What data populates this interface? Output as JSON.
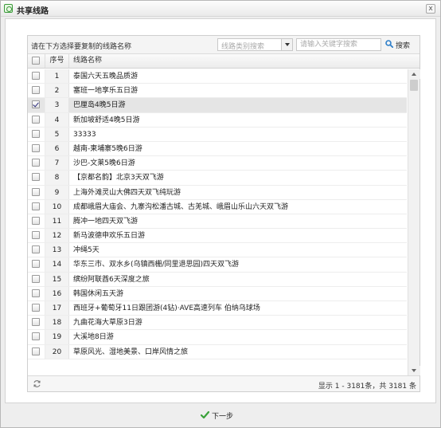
{
  "window": {
    "title": "共享线路",
    "close_label": "x"
  },
  "toolbar": {
    "instruction": "请在下方选择要复制的线路名称",
    "category_placeholder": "线路类别搜索",
    "keyword_placeholder": "请输入关键字搜索",
    "search_label": "搜索"
  },
  "grid": {
    "columns": {
      "seq": "序号",
      "name": "线路名称"
    },
    "rows": [
      {
        "seq": "1",
        "name": "泰国六天五晚品质游",
        "checked": false
      },
      {
        "seq": "2",
        "name": "塞班一地享乐五日游",
        "checked": false
      },
      {
        "seq": "3",
        "name": "巴厘岛4晚5日游",
        "checked": true
      },
      {
        "seq": "4",
        "name": "新加坡舒适4晚5日游",
        "checked": false
      },
      {
        "seq": "5",
        "name": "33333",
        "checked": false
      },
      {
        "seq": "6",
        "name": "越南-柬埔寨5晚6日游",
        "checked": false
      },
      {
        "seq": "7",
        "name": "沙巴-文莱5晚6日游",
        "checked": false
      },
      {
        "seq": "8",
        "name": "【京都名韵】北京3天双飞游",
        "checked": false
      },
      {
        "seq": "9",
        "name": "上海外滩灵山大佛四天双飞纯玩游",
        "checked": false
      },
      {
        "seq": "10",
        "name": "成都峨眉大庙会、九寨沟松潘古城、古羌城、峨眉山乐山六天双飞游",
        "checked": false
      },
      {
        "seq": "11",
        "name": "腾冲一地四天双飞游",
        "checked": false
      },
      {
        "seq": "12",
        "name": "新马波德申欢乐五日游",
        "checked": false
      },
      {
        "seq": "13",
        "name": "冲绳5天",
        "checked": false
      },
      {
        "seq": "14",
        "name": "华东三市、双水乡(乌镇西栅/同里退思园)四天双飞游",
        "checked": false
      },
      {
        "seq": "15",
        "name": "缤纷阿联酋6天深度之旅",
        "checked": false
      },
      {
        "seq": "16",
        "name": "韩国休闲五天游",
        "checked": false
      },
      {
        "seq": "17",
        "name": "西班牙+葡萄牙11日跟团游(4钻)·AVE高速列车 伯纳乌球场",
        "checked": false
      },
      {
        "seq": "18",
        "name": "九曲花海大草原3日游",
        "checked": false
      },
      {
        "seq": "19",
        "name": "大溪地8日游",
        "checked": false
      },
      {
        "seq": "20",
        "name": "草原风光、湿地美景、口岸风情之旅",
        "checked": false
      }
    ]
  },
  "pager": {
    "text": "显示 1 - 3181条，共 3181 条"
  },
  "footer": {
    "next_label": "下一步"
  },
  "colors": {
    "accent": "#2f7fc9",
    "check_green": "#3aa23a",
    "selected_row": "#e5e5e5"
  }
}
